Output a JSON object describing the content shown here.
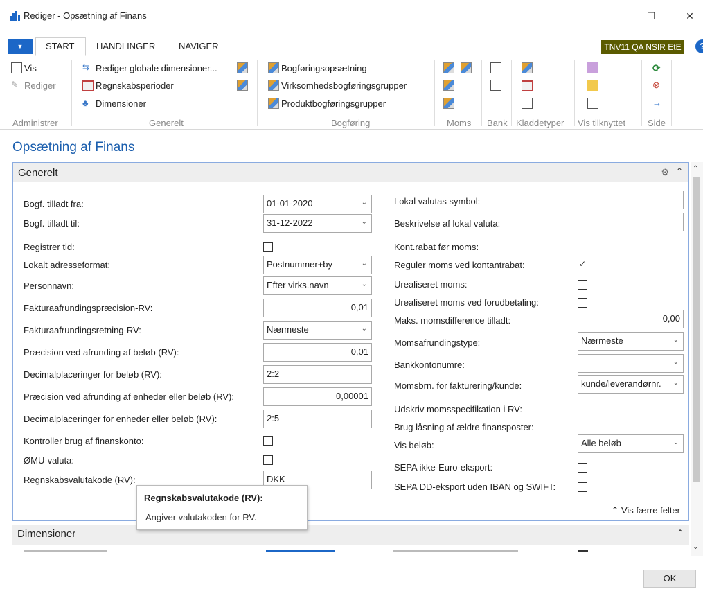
{
  "window": {
    "title": "Rediger - Opsætning af Finans",
    "minimize": "—",
    "maximize": "☐",
    "close": "✕"
  },
  "menu": {
    "dropdown_symbol": "▼",
    "tabs": [
      "START",
      "HANDLINGER",
      "NAVIGER"
    ],
    "company": "TNV11 QA NSIR EtE",
    "help": "?"
  },
  "ribbon": {
    "administrer": {
      "label": "Administrer",
      "vis": "Vis",
      "rediger": "Rediger"
    },
    "generelt": {
      "label": "Generelt",
      "items": [
        "Rediger globale dimensioner...",
        "Regnskabsperioder",
        "Dimensioner"
      ]
    },
    "bogforing": {
      "label": "Bogføring",
      "items": [
        "Bogføringsopsætning",
        "Virksomhedsbogføringsgrupper",
        "Produktbogføringsgrupper"
      ]
    },
    "moms": {
      "label": "Moms"
    },
    "bank": {
      "label": "Bank"
    },
    "kladdetyper": {
      "label": "Kladdetyper"
    },
    "vis_tilknyttet": {
      "label": "Vis tilknyttet"
    },
    "side": {
      "label": "Side"
    }
  },
  "page": {
    "title": "Opsætning af Finans"
  },
  "generelt": {
    "header": "Generelt",
    "left": [
      {
        "label": "Bogf. tilladt fra:",
        "value": "01-01-2020"
      },
      {
        "label": "Bogf. tilladt til:",
        "value": "31-12-2022"
      },
      {
        "label": "Registrer tid:",
        "checked": false
      },
      {
        "label": "Lokalt adresseformat:",
        "value": "Postnummer+by"
      },
      {
        "label": "Personnavn:",
        "value": "Efter virks.navn"
      },
      {
        "label": "Fakturaafrundingspræcision-RV:",
        "value": "0,01"
      },
      {
        "label": "Fakturaafrundingsretning-RV:",
        "value": "Nærmeste"
      },
      {
        "label": "Præcision ved afrunding af beløb (RV):",
        "value": "0,01"
      },
      {
        "label": "Decimalplaceringer for beløb (RV):",
        "value": "2:2"
      },
      {
        "label": "Præcision ved afrunding af enheder eller beløb (RV):",
        "value": "0,00001"
      },
      {
        "label": "Decimalplaceringer for enheder eller beløb (RV):",
        "value": "2:5"
      },
      {
        "label": "Kontroller brug af finanskonto:",
        "checked": false
      },
      {
        "label": "ØMU-valuta:",
        "checked": false
      },
      {
        "label": "Regnskabsvalutakode (RV):",
        "value": "DKK"
      }
    ],
    "right": [
      {
        "label": "Lokal valutas symbol:",
        "value": ""
      },
      {
        "label": "Beskrivelse af lokal valuta:",
        "value": ""
      },
      {
        "label": "Kont.rabat før moms:",
        "checked": false
      },
      {
        "label": "Reguler moms ved kontantrabat:",
        "checked": true
      },
      {
        "label": "Urealiseret moms:",
        "checked": false
      },
      {
        "label": "Urealiseret moms ved forudbetaling:",
        "checked": false
      },
      {
        "label": "Maks. momsdifference tilladt:",
        "value": "0,00"
      },
      {
        "label": "Momsafrundingstype:",
        "value": "Nærmeste"
      },
      {
        "label": "Bankkontonumre:",
        "value": ""
      },
      {
        "label": "Momsbrn. for fakturering/kunde:",
        "value": "kunde/leverandørnr."
      },
      {
        "label": "Udskriv momsspecifikation i RV:",
        "checked": false
      },
      {
        "label": "Brug låsning af ældre finansposter:",
        "checked": false
      },
      {
        "label": "Vis beløb:",
        "value": "Alle beløb"
      },
      {
        "label": "SEPA ikke-Euro-eksport:",
        "checked": false
      },
      {
        "label": "SEPA DD-eksport uden IBAN og SWIFT:",
        "checked": false
      }
    ],
    "less_fields": "Vis færre felter"
  },
  "tooltip": {
    "title": "Regnskabsvalutakode (RV):",
    "body": "Angiver valutakoden for RV."
  },
  "dimensioner": {
    "header": "Dimensioner"
  },
  "footer": {
    "ok": "OK"
  },
  "colors": {
    "accent": "#1c67c7",
    "title_blue": "#1c5fae",
    "badge": "#5b5b00"
  }
}
